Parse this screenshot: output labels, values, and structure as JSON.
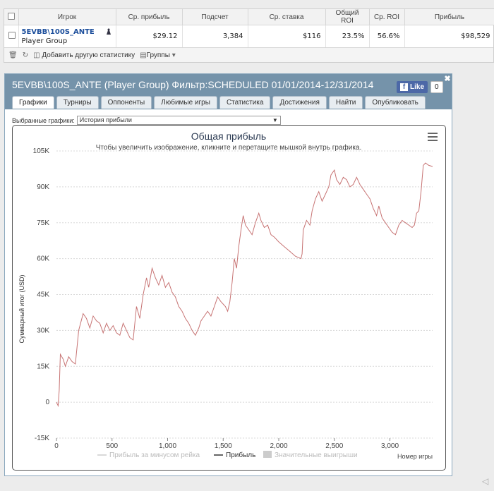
{
  "stats_table": {
    "headers": [
      "Игрок",
      "Ср. прибыль",
      "Подсчет",
      "Ср. ставка",
      "Общий ROI",
      "Ср. ROI",
      "Прибыль"
    ],
    "row": {
      "player_name": "5EVBB\\100S_ANTE",
      "player_group": "Player Group",
      "avg_profit": "$29.12",
      "count": "3,384",
      "avg_stake": "$116",
      "total_roi": "23.5%",
      "avg_roi": "56.6%",
      "profit": "$98,529"
    },
    "toolbar": {
      "add_stats": "Добавить другую статистику",
      "groups": "Группы"
    }
  },
  "panel": {
    "title": "5EVBB\\100S_ANTE (Player Group) Фильтр:SCHEDULED 01/01/2014-12/31/2014",
    "like_label": "Like",
    "like_count": "0",
    "tabs": [
      "Графики",
      "Турниры",
      "Оппоненты",
      "Любимые игры",
      "Статистика",
      "Достижения",
      "Найти",
      "Опубликовать"
    ],
    "active_tab": 0,
    "selected_charts_label": "Выбранные графики:",
    "selected_chart": "История прибыли"
  },
  "chart_data": {
    "type": "line",
    "title": "Общая прибыль",
    "subtitle": "Чтобы увеличить изображение, кликните и перетащите мышкой внутрь графика.",
    "xlabel": "Номер игры",
    "ylabel": "Суммарный итог (USD)",
    "xlim": [
      0,
      3384
    ],
    "ylim": [
      -15000,
      105000
    ],
    "x_ticks": [
      0,
      500,
      1000,
      1500,
      2000,
      2500,
      3000
    ],
    "x_tick_labels": [
      "0",
      "500",
      "1,000",
      "1,500",
      "2,000",
      "2,500",
      "3,000"
    ],
    "y_ticks": [
      -15000,
      0,
      15000,
      30000,
      45000,
      60000,
      75000,
      90000,
      105000
    ],
    "y_tick_labels": [
      "-15K",
      "0",
      "15K",
      "30K",
      "45K",
      "60K",
      "75K",
      "90K",
      "105K"
    ],
    "grid": true,
    "legend": [
      "Прибыль за минусом рейка",
      "Прибыль",
      "Значительные выигрыши"
    ],
    "legend_placement": "bottom",
    "line_color": "#c77373",
    "series": [
      {
        "name": "Прибыль",
        "points": [
          [
            0,
            0
          ],
          [
            15,
            -1500
          ],
          [
            25,
            5000
          ],
          [
            35,
            20000
          ],
          [
            60,
            18000
          ],
          [
            80,
            15000
          ],
          [
            110,
            19000
          ],
          [
            140,
            17000
          ],
          [
            170,
            16000
          ],
          [
            200,
            30000
          ],
          [
            240,
            37000
          ],
          [
            270,
            35000
          ],
          [
            300,
            31000
          ],
          [
            330,
            36000
          ],
          [
            360,
            34000
          ],
          [
            390,
            33000
          ],
          [
            420,
            29000
          ],
          [
            450,
            33000
          ],
          [
            480,
            30000
          ],
          [
            510,
            32000
          ],
          [
            540,
            29000
          ],
          [
            570,
            28000
          ],
          [
            600,
            33000
          ],
          [
            630,
            30000
          ],
          [
            660,
            27000
          ],
          [
            690,
            26000
          ],
          [
            720,
            40000
          ],
          [
            750,
            35000
          ],
          [
            780,
            45000
          ],
          [
            810,
            52000
          ],
          [
            830,
            48000
          ],
          [
            860,
            56000
          ],
          [
            890,
            52000
          ],
          [
            920,
            49000
          ],
          [
            950,
            53000
          ],
          [
            980,
            48000
          ],
          [
            1010,
            50000
          ],
          [
            1040,
            46000
          ],
          [
            1070,
            44000
          ],
          [
            1100,
            40000
          ],
          [
            1130,
            38000
          ],
          [
            1160,
            35000
          ],
          [
            1190,
            33000
          ],
          [
            1220,
            30000
          ],
          [
            1250,
            28000
          ],
          [
            1280,
            31000
          ],
          [
            1300,
            34000
          ],
          [
            1330,
            36000
          ],
          [
            1360,
            38000
          ],
          [
            1390,
            36000
          ],
          [
            1420,
            40000
          ],
          [
            1450,
            44000
          ],
          [
            1480,
            42000
          ],
          [
            1500,
            41000
          ],
          [
            1520,
            40000
          ],
          [
            1540,
            38000
          ],
          [
            1560,
            42000
          ],
          [
            1580,
            50000
          ],
          [
            1600,
            60000
          ],
          [
            1620,
            56000
          ],
          [
            1640,
            65000
          ],
          [
            1660,
            72000
          ],
          [
            1680,
            78000
          ],
          [
            1700,
            74000
          ],
          [
            1730,
            72000
          ],
          [
            1760,
            70000
          ],
          [
            1790,
            75000
          ],
          [
            1820,
            79000
          ],
          [
            1840,
            76000
          ],
          [
            1870,
            73000
          ],
          [
            1900,
            74000
          ],
          [
            1930,
            70000
          ],
          [
            1960,
            69000
          ],
          [
            2000,
            67000
          ],
          [
            2050,
            65000
          ],
          [
            2100,
            63000
          ],
          [
            2150,
            61000
          ],
          [
            2200,
            60000
          ],
          [
            2210,
            62000
          ],
          [
            2220,
            72000
          ],
          [
            2250,
            76000
          ],
          [
            2280,
            74000
          ],
          [
            2300,
            80000
          ],
          [
            2330,
            85000
          ],
          [
            2360,
            88000
          ],
          [
            2390,
            84000
          ],
          [
            2420,
            87000
          ],
          [
            2450,
            90000
          ],
          [
            2470,
            95000
          ],
          [
            2500,
            97000
          ],
          [
            2520,
            93000
          ],
          [
            2550,
            91000
          ],
          [
            2580,
            94000
          ],
          [
            2610,
            93000
          ],
          [
            2640,
            90000
          ],
          [
            2670,
            91000
          ],
          [
            2700,
            94000
          ],
          [
            2730,
            91000
          ],
          [
            2760,
            89000
          ],
          [
            2790,
            87000
          ],
          [
            2820,
            85000
          ],
          [
            2850,
            81000
          ],
          [
            2880,
            78000
          ],
          [
            2900,
            82000
          ],
          [
            2930,
            77000
          ],
          [
            2960,
            75000
          ],
          [
            2990,
            73000
          ],
          [
            3020,
            71000
          ],
          [
            3050,
            70000
          ],
          [
            3080,
            74000
          ],
          [
            3110,
            76000
          ],
          [
            3140,
            75000
          ],
          [
            3170,
            74000
          ],
          [
            3200,
            73000
          ],
          [
            3220,
            74000
          ],
          [
            3240,
            79000
          ],
          [
            3260,
            80000
          ],
          [
            3280,
            88000
          ],
          [
            3300,
            99000
          ],
          [
            3320,
            100000
          ],
          [
            3350,
            99000
          ],
          [
            3384,
            98500
          ]
        ]
      }
    ]
  }
}
